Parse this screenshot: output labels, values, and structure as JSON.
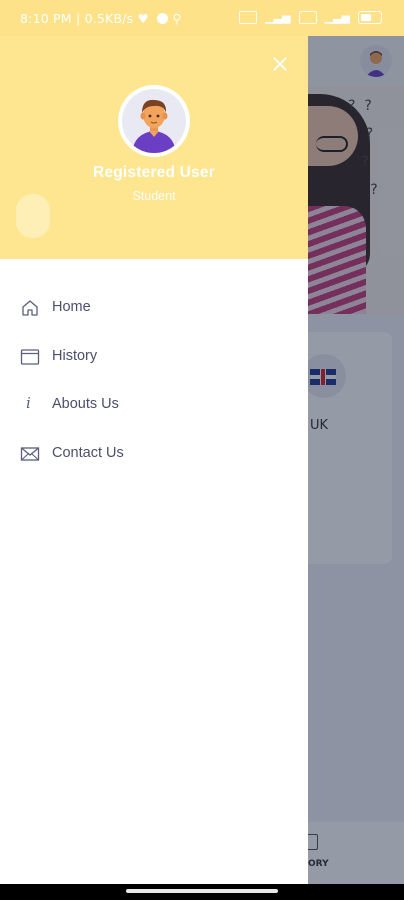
{
  "status_bar": {
    "time": "8:10 PM",
    "speed": "0.5KB/s",
    "right_icons": [
      "vibrate-icon",
      "signal-icon",
      "wifi-icon",
      "signal-icon",
      "battery-icon"
    ]
  },
  "drawer": {
    "user_name": "Registered User",
    "user_role": "Student",
    "header_color": "#fde68f",
    "menu": [
      {
        "label": "Home",
        "icon": "home-icon"
      },
      {
        "label": "History",
        "icon": "history-icon"
      },
      {
        "label": "Abouts Us",
        "icon": "info-icon"
      },
      {
        "label": "Contact Us",
        "icon": "mail-icon"
      }
    ]
  },
  "background_app": {
    "card_label": "UK",
    "bottom_nav_label": "ORY"
  },
  "colors": {
    "accent_yellow": "#fde68f",
    "menu_text": "#4a4f6e"
  }
}
